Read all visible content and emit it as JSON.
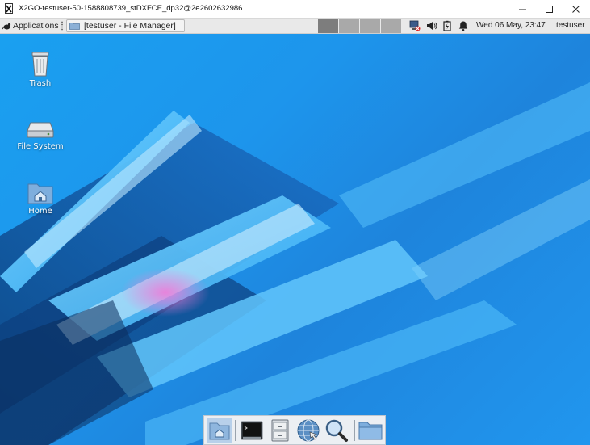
{
  "window": {
    "title": "X2GO-testuser-50-1588808739_stDXFCE_dp32@2e2602632986",
    "buttons": [
      "minimize",
      "maximize",
      "close"
    ]
  },
  "panel": {
    "applications_label": "Applications",
    "task_label": "[testuser - File Manager]",
    "workspaces": [
      {
        "color": "#7d7d7d",
        "active": true
      },
      {
        "color": "#a9a9a9",
        "active": false
      },
      {
        "color": "#a9a9a9",
        "active": false
      },
      {
        "color": "#a9a9a9",
        "active": false
      }
    ],
    "tray_icons": [
      "network-disconnected-icon",
      "volume-icon",
      "battery-icon",
      "notification-bell-icon"
    ],
    "clock": "Wed 06 May, 23:47",
    "username": "testuser"
  },
  "desktop": {
    "icons": [
      {
        "label": "Trash",
        "icon": "trash-icon"
      },
      {
        "label": "File System",
        "icon": "drive-icon"
      },
      {
        "label": "Home",
        "icon": "home-folder-icon"
      }
    ]
  },
  "dock": {
    "items": [
      "show-desktop-icon",
      "terminal-icon",
      "file-manager-icon",
      "web-browser-icon",
      "app-finder-icon",
      "folder-icon"
    ]
  },
  "colors": {
    "desktop_background": "#1e90ea",
    "panel_background": "#e9e9e9",
    "active_workspace": "#7d7d7d"
  }
}
